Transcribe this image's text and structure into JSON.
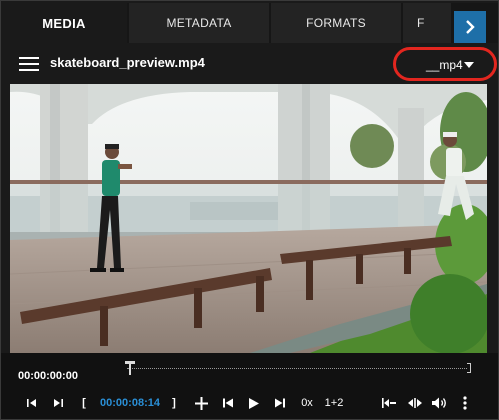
{
  "tabs": [
    {
      "label": "MEDIA",
      "active": true
    },
    {
      "label": "METADATA",
      "active": false
    },
    {
      "label": "FORMATS",
      "active": false
    },
    {
      "label": "F",
      "active": false
    }
  ],
  "header": {
    "file_title": "skateboard_preview.mp4",
    "format_value": "__mp4"
  },
  "controls": {
    "current_time": "00:00:00:00",
    "mark_in_time": "00:00:08:14",
    "open_bracket": "[",
    "close_bracket": "]",
    "speed": "0x",
    "channels": "1+2",
    "progress_fraction": 0.0
  },
  "colors": {
    "accent": "#1e6fa8",
    "highlight_ring": "#e3261f",
    "timecode_blue": "#2a8fd6"
  },
  "icons": [
    "menu-icon",
    "chevron-right-icon",
    "caret-down-icon",
    "go-to-start-icon",
    "go-to-end-icon",
    "plus-icon",
    "skip-back-icon",
    "play-icon",
    "skip-forward-icon",
    "trim-icon",
    "split-icon",
    "volume-icon",
    "more-vertical-icon"
  ]
}
